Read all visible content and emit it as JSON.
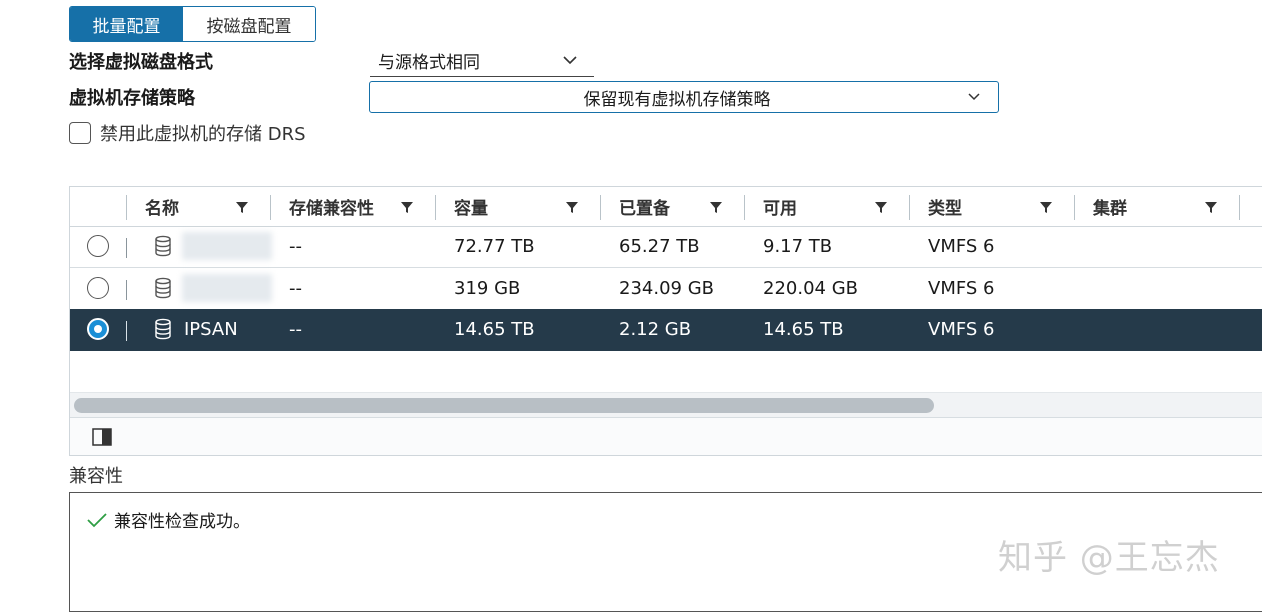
{
  "toggle": {
    "batch_label": "批量配置",
    "per_disk_label": "按磁盘配置"
  },
  "disk_format": {
    "label": "选择虚拟磁盘格式",
    "value": "与源格式相同"
  },
  "storage_policy": {
    "label": "虚拟机存储策略",
    "value": "保留现有虚拟机存储策略"
  },
  "drs_checkbox": {
    "label": "禁用此虚拟机的存储 DRS",
    "checked": false
  },
  "table": {
    "columns": [
      "名称",
      "存储兼容性",
      "容量",
      "已置备",
      "可用",
      "类型",
      "集群"
    ],
    "rows": [
      {
        "name": "",
        "compat": "--",
        "capacity": "72.77 TB",
        "provisioned": "65.27 TB",
        "free": "9.17 TB",
        "type": "VMFS 6",
        "cluster": "",
        "selected": false
      },
      {
        "name": "",
        "compat": "--",
        "capacity": "319 GB",
        "provisioned": "234.09 GB",
        "free": "220.04 GB",
        "type": "VMFS 6",
        "cluster": "",
        "selected": false
      },
      {
        "name": "IPSAN",
        "compat": "--",
        "capacity": "14.65 TB",
        "provisioned": "2.12 GB",
        "free": "14.65 TB",
        "type": "VMFS 6",
        "cluster": "",
        "selected": true
      }
    ]
  },
  "compatibility": {
    "label": "兼容性",
    "message": "兼容性检查成功。"
  },
  "watermark": "知乎 @王忘杰",
  "colors": {
    "accent": "#1670a8",
    "selected_row": "#253a4a",
    "radio_selected": "#1b8fd6",
    "success": "#2e9e44"
  }
}
